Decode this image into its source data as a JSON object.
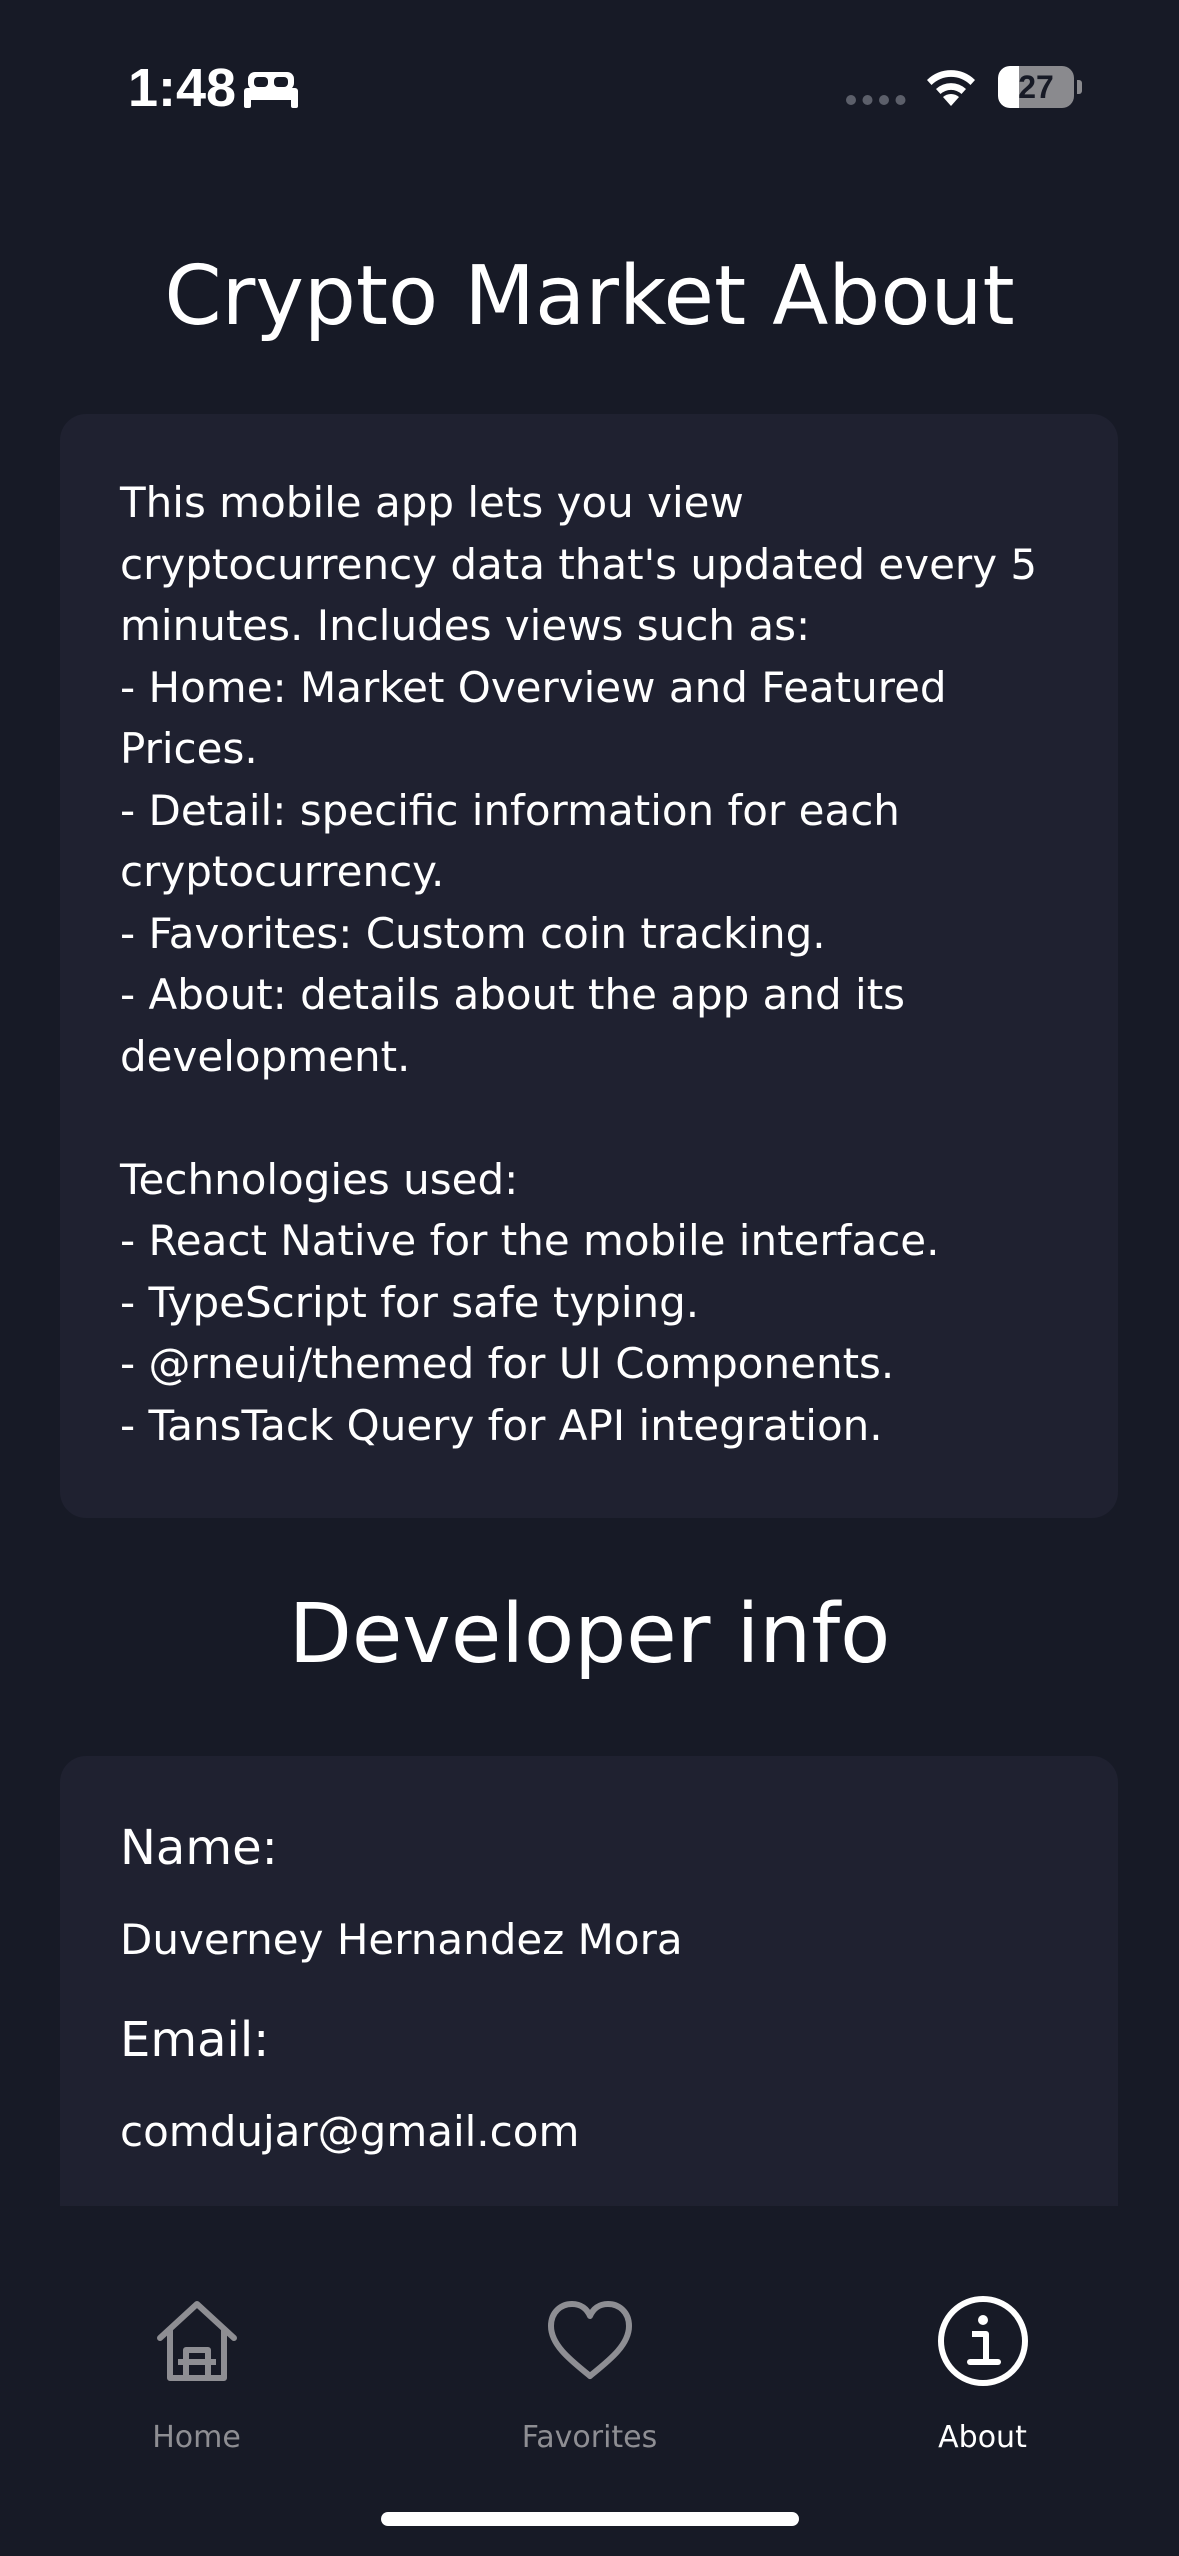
{
  "status_bar": {
    "time": "1:48",
    "battery_level": "27",
    "battery_fraction": 0.27,
    "icons": [
      "bed-icon",
      "cellular-dots-icon",
      "wifi-icon",
      "battery-icon"
    ]
  },
  "about": {
    "title": "Crypto Market About",
    "description": "This mobile app lets you view cryptocurrency data that's updated every 5 minutes. Includes views such as:\n- Home: Market Overview and Featured Prices.\n- Detail: specific information for each cryptocurrency.\n- Favorites: Custom coin tracking.\n- About: details about the app and its development.\n\nTechnologies used:\n- React Native for the mobile interface.\n- TypeScript for safe typing.\n- @rneui/themed for UI Components.\n- TansTack Query for API integration."
  },
  "developer": {
    "title": "Developer info",
    "name_label": "Name:",
    "name_value": "Duverney Hernandez Mora",
    "email_label": "Email:",
    "email_value": "comdujar@gmail.com"
  },
  "tabs": [
    {
      "label": "Home",
      "icon": "home-icon",
      "active": false
    },
    {
      "label": "Favorites",
      "icon": "heart-icon",
      "active": false
    },
    {
      "label": "About",
      "icon": "info-icon",
      "active": true
    }
  ],
  "colors": {
    "background": "#171a26",
    "card": "#1f2130",
    "text": "#ffffff",
    "inactive_tab": "#8e8e93"
  }
}
